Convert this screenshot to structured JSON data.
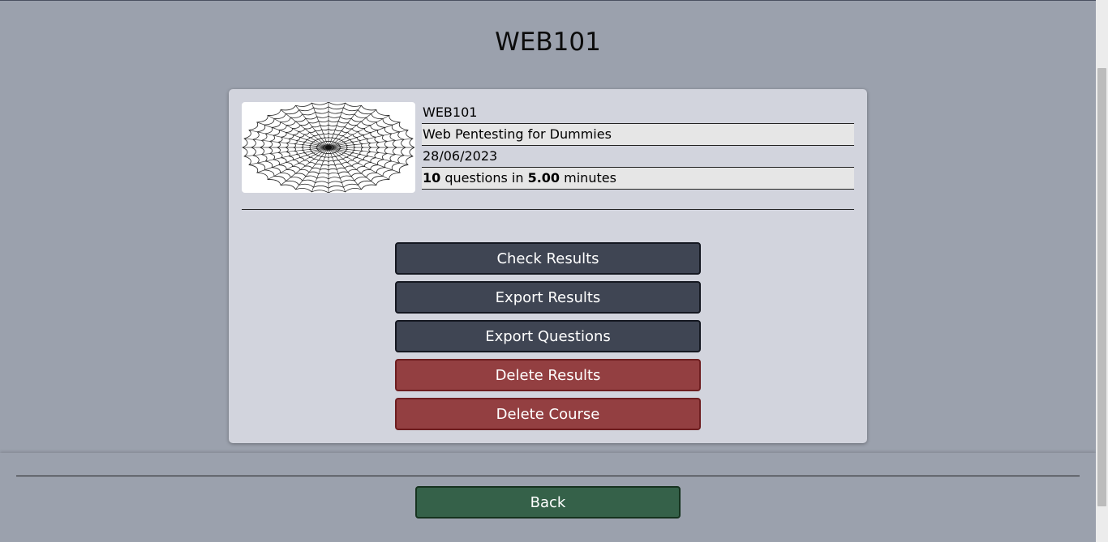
{
  "page": {
    "title": "WEB101"
  },
  "course": {
    "image_icon": "spider-web-icon",
    "code": "WEB101",
    "name": "Web Pentesting for Dummies",
    "date": "28/06/2023",
    "question_count": "10",
    "questions_in_text": " questions in ",
    "duration": "5.00",
    "minutes_text": " minutes"
  },
  "actions": {
    "check_results": "Check Results",
    "export_results": "Export Results",
    "export_questions": "Export Questions",
    "delete_results": "Delete Results",
    "delete_course": "Delete Course"
  },
  "footer": {
    "back": "Back"
  },
  "colors": {
    "background": "#9ba1ad",
    "card": "#d2d4dd",
    "primary_button": "#3f4553",
    "danger_button": "#933f41",
    "back_button": "#356149"
  }
}
